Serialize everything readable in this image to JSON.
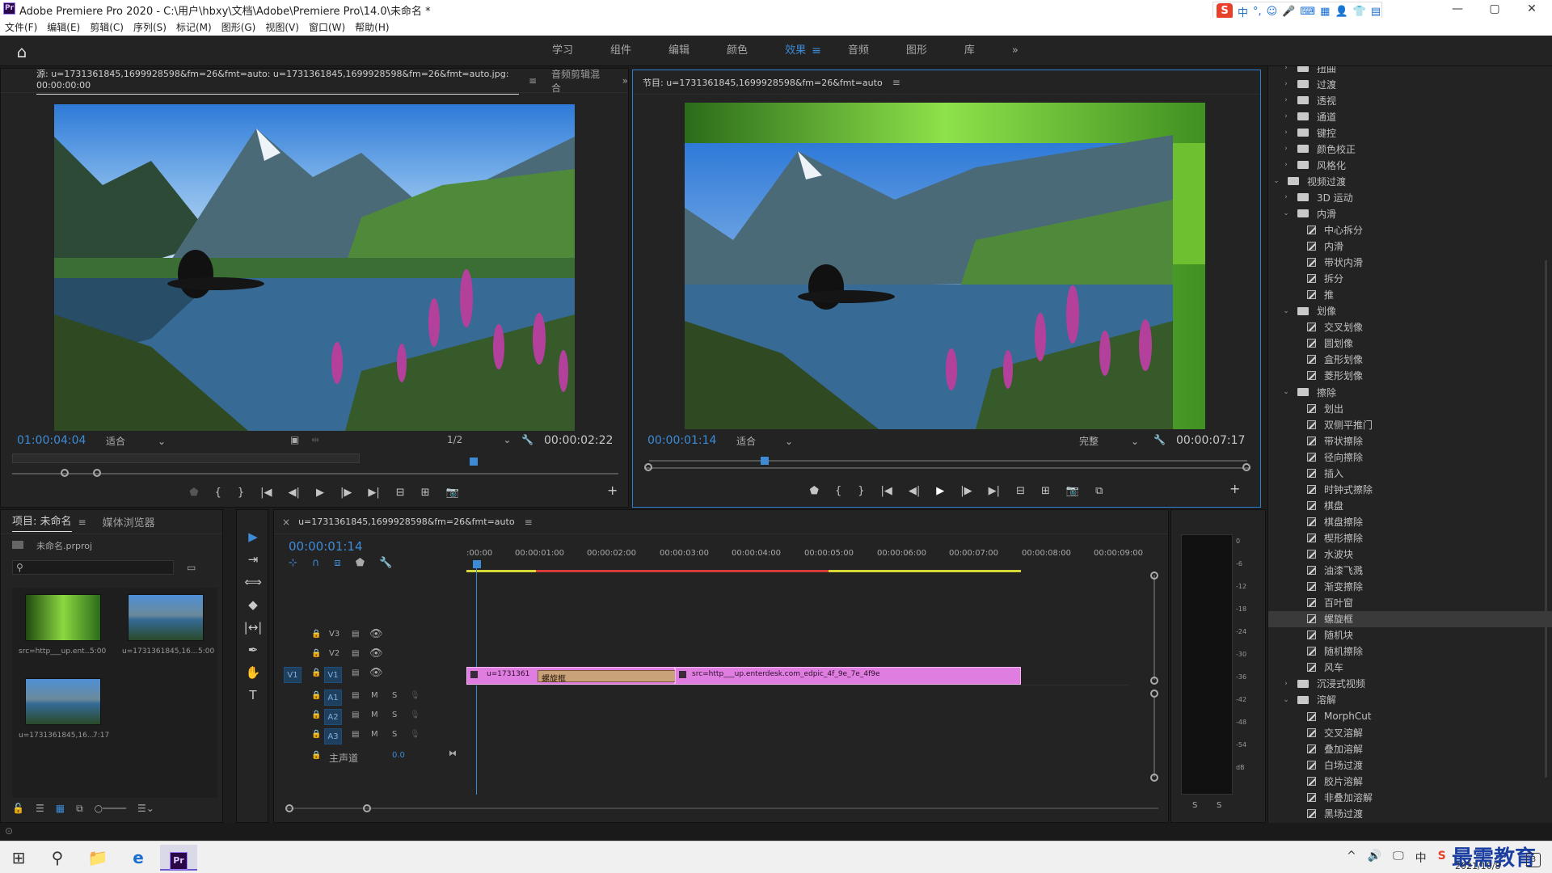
{
  "window": {
    "title": "Adobe Premiere Pro 2020 - C:\\用户\\hbxy\\文档\\Adobe\\Premiere Pro\\14.0\\未命名 *",
    "app_icon_text": "Pr",
    "minimize": "—",
    "maximize": "▢",
    "close": "✕"
  },
  "ime_toolbar": {
    "logo": "S",
    "mode": "中",
    "punct": "°,",
    "icons": [
      "☺",
      "🎤",
      "⌨",
      "▦",
      "👤",
      "👕",
      "▤"
    ]
  },
  "menu": [
    "文件(F)",
    "编辑(E)",
    "剪辑(C)",
    "序列(S)",
    "标记(M)",
    "图形(G)",
    "视图(V)",
    "窗口(W)",
    "帮助(H)"
  ],
  "workspace": {
    "tabs": [
      "学习",
      "组件",
      "编辑",
      "颜色",
      "效果",
      "音频",
      "图形",
      "库"
    ],
    "active": "效果",
    "more": "»"
  },
  "source_monitor": {
    "tab_label": "源: u=1731361845,1699928598&fm=26&fmt=auto: u=1731361845,1699928598&fm=26&fmt=auto.jpg: 00:00:00:00",
    "tab2_label": "音频剪辑混合",
    "menu_icon": "≡",
    "more": "»",
    "timecode_in": "01:00:04:04",
    "fit": "适合",
    "resolution": "1/2",
    "duration": "00:00:02:22"
  },
  "program_monitor": {
    "tab_label": "节目: u=1731361845,1699928598&fm=26&fmt=auto",
    "menu_icon": "≡",
    "timecode": "00:00:01:14",
    "fit": "适合",
    "quality": "完整",
    "duration": "00:00:07:17"
  },
  "transport_glyphs": {
    "marker": "⬟",
    "in": "{",
    "out": "}",
    "go_in": "|◀",
    "step_back": "◀|",
    "play": "▶",
    "step_fwd": "|▶",
    "go_out": "▶|",
    "insert": "⊟",
    "overwrite": "⊞",
    "export": "📷",
    "compare": "⧉",
    "add": "+",
    "wrench": "🔧",
    "dropdown": "⌄"
  },
  "project_panel": {
    "tab_label": "项目: 未命名",
    "menu_icon": "≡",
    "tab2_label": "媒体浏览器",
    "project_file": "未命名.prproj",
    "search_placeholder": "",
    "items": [
      {
        "name": "src=http___up.ent...",
        "duration": "5:00"
      },
      {
        "name": "u=1731361845,16...",
        "duration": "5:00"
      },
      {
        "name": "u=1731361845,16...",
        "duration": "7:17"
      }
    ]
  },
  "tools": [
    "▶",
    "⇥",
    "⟺",
    "◆",
    "|↔|",
    "✒",
    "✋",
    "T"
  ],
  "timeline": {
    "tab_label": "u=1731361845,1699928598&fm=26&fmt=auto",
    "close": "×",
    "menu_icon": "≡",
    "timecode": "00:00:01:14",
    "ruler": [
      ":00:00",
      "00:00:01:00",
      "00:00:02:00",
      "00:00:03:00",
      "00:00:04:00",
      "00:00:05:00",
      "00:00:06:00",
      "00:00:07:00",
      "00:00:08:00",
      "00:00:09:00"
    ],
    "video_tracks": [
      "V3",
      "V2",
      "V1"
    ],
    "audio_tracks": [
      "A1",
      "A2",
      "A3"
    ],
    "source_patch": "V1",
    "master_label": "主声道",
    "master_value": "0.0",
    "mute": "M",
    "solo": "S",
    "clips": {
      "clip1": "u=1731361",
      "transition": "螺旋框",
      "clip2": "src=http___up.enterdesk.com_edpic_4f_9e_7e_4f9e"
    }
  },
  "audio_meter": {
    "scale": [
      "0",
      "-6",
      "-12",
      "-18",
      "-24",
      "-30",
      "-36",
      "-42",
      "-48",
      "-54",
      "dB"
    ],
    "solo_left": "S",
    "solo_right": "S"
  },
  "effects_tree": [
    {
      "label": "扭曲",
      "kind": "folder",
      "level": 1,
      "expanded": false
    },
    {
      "label": "过渡",
      "kind": "folder",
      "level": 1,
      "expanded": false
    },
    {
      "label": "透视",
      "kind": "folder",
      "level": 1,
      "expanded": false
    },
    {
      "label": "通道",
      "kind": "folder",
      "level": 1,
      "expanded": false
    },
    {
      "label": "键控",
      "kind": "folder",
      "level": 1,
      "expanded": false
    },
    {
      "label": "颜色校正",
      "kind": "folder",
      "level": 1,
      "expanded": false
    },
    {
      "label": "风格化",
      "kind": "folder",
      "level": 1,
      "expanded": false
    },
    {
      "label": "视频过渡",
      "kind": "folder",
      "level": 0,
      "expanded": true
    },
    {
      "label": "3D 运动",
      "kind": "folder",
      "level": 1,
      "expanded": false
    },
    {
      "label": "内滑",
      "kind": "folder",
      "level": 1,
      "expanded": true
    },
    {
      "label": "中心拆分",
      "kind": "effect",
      "level": 2
    },
    {
      "label": "内滑",
      "kind": "effect",
      "level": 2
    },
    {
      "label": "带状内滑",
      "kind": "effect",
      "level": 2
    },
    {
      "label": "拆分",
      "kind": "effect",
      "level": 2
    },
    {
      "label": "推",
      "kind": "effect",
      "level": 2
    },
    {
      "label": "划像",
      "kind": "folder",
      "level": 1,
      "expanded": true
    },
    {
      "label": "交叉划像",
      "kind": "effect",
      "level": 2
    },
    {
      "label": "圆划像",
      "kind": "effect",
      "level": 2
    },
    {
      "label": "盒形划像",
      "kind": "effect",
      "level": 2
    },
    {
      "label": "菱形划像",
      "kind": "effect",
      "level": 2
    },
    {
      "label": "擦除",
      "kind": "folder",
      "level": 1,
      "expanded": true
    },
    {
      "label": "划出",
      "kind": "effect",
      "level": 2
    },
    {
      "label": "双侧平推门",
      "kind": "effect",
      "level": 2
    },
    {
      "label": "带状擦除",
      "kind": "effect",
      "level": 2
    },
    {
      "label": "径向擦除",
      "kind": "effect",
      "level": 2
    },
    {
      "label": "插入",
      "kind": "effect",
      "level": 2
    },
    {
      "label": "时钟式擦除",
      "kind": "effect",
      "level": 2
    },
    {
      "label": "棋盘",
      "kind": "effect",
      "level": 2
    },
    {
      "label": "棋盘擦除",
      "kind": "effect",
      "level": 2
    },
    {
      "label": "楔形擦除",
      "kind": "effect",
      "level": 2
    },
    {
      "label": "水波块",
      "kind": "effect",
      "level": 2
    },
    {
      "label": "油漆飞溅",
      "kind": "effect",
      "level": 2
    },
    {
      "label": "渐变擦除",
      "kind": "effect",
      "level": 2
    },
    {
      "label": "百叶窗",
      "kind": "effect",
      "level": 2
    },
    {
      "label": "螺旋框",
      "kind": "effect",
      "level": 2,
      "selected": true
    },
    {
      "label": "随机块",
      "kind": "effect",
      "level": 2
    },
    {
      "label": "随机擦除",
      "kind": "effect",
      "level": 2
    },
    {
      "label": "风车",
      "kind": "effect",
      "level": 2
    },
    {
      "label": "沉浸式视频",
      "kind": "folder",
      "level": 1,
      "expanded": false
    },
    {
      "label": "溶解",
      "kind": "folder",
      "level": 1,
      "expanded": true
    },
    {
      "label": "MorphCut",
      "kind": "effect",
      "level": 2
    },
    {
      "label": "交叉溶解",
      "kind": "effect",
      "level": 2
    },
    {
      "label": "叠加溶解",
      "kind": "effect",
      "level": 2
    },
    {
      "label": "白场过渡",
      "kind": "effect",
      "level": 2
    },
    {
      "label": "胶片溶解",
      "kind": "effect",
      "level": 2
    },
    {
      "label": "非叠加溶解",
      "kind": "effect",
      "level": 2
    },
    {
      "label": "黑场过渡",
      "kind": "effect",
      "level": 2
    }
  ],
  "taskbar": {
    "date": "2021/10/8",
    "watermark": "最需教育",
    "notification_count": "3",
    "icons": [
      "⊞",
      "⚲",
      "📁",
      "e",
      "Pr"
    ],
    "tray": [
      "^",
      "🔊",
      "🖵",
      "中",
      "S"
    ]
  },
  "colors": {
    "accent_blue": "#3d8bd7",
    "clip_pink": "#e07de0",
    "transition_tan": "#c9a27a",
    "panel_bg": "#232323",
    "workarea_yellow": "#d7d738",
    "render_red": "#d43b3b"
  }
}
